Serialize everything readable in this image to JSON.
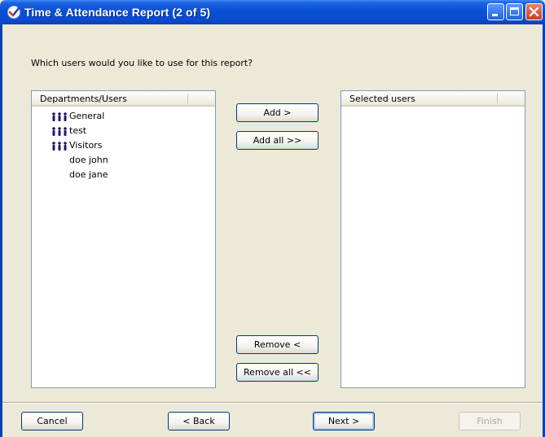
{
  "window": {
    "title": "Time & Attendance Report (2 of 5)",
    "titlebar_color": "#0a4fd6"
  },
  "prompt": "Which users would you like to use for this report?",
  "left_list": {
    "header": "Departments/Users",
    "items": [
      {
        "label": "General",
        "type": "department",
        "icon": "department-icon"
      },
      {
        "label": "test",
        "type": "department",
        "icon": "department-icon"
      },
      {
        "label": "Visitors",
        "type": "department",
        "icon": "department-icon"
      },
      {
        "label": "doe john",
        "type": "user"
      },
      {
        "label": "doe jane",
        "type": "user"
      }
    ]
  },
  "right_list": {
    "header": "Selected users",
    "items": []
  },
  "transfer_buttons": {
    "add": "Add >",
    "add_all": "Add all >>",
    "remove": "Remove <",
    "remove_all": "Remove all <<"
  },
  "nav_buttons": {
    "cancel": "Cancel",
    "back": "< Back",
    "next": "Next >",
    "finish": "Finish"
  }
}
